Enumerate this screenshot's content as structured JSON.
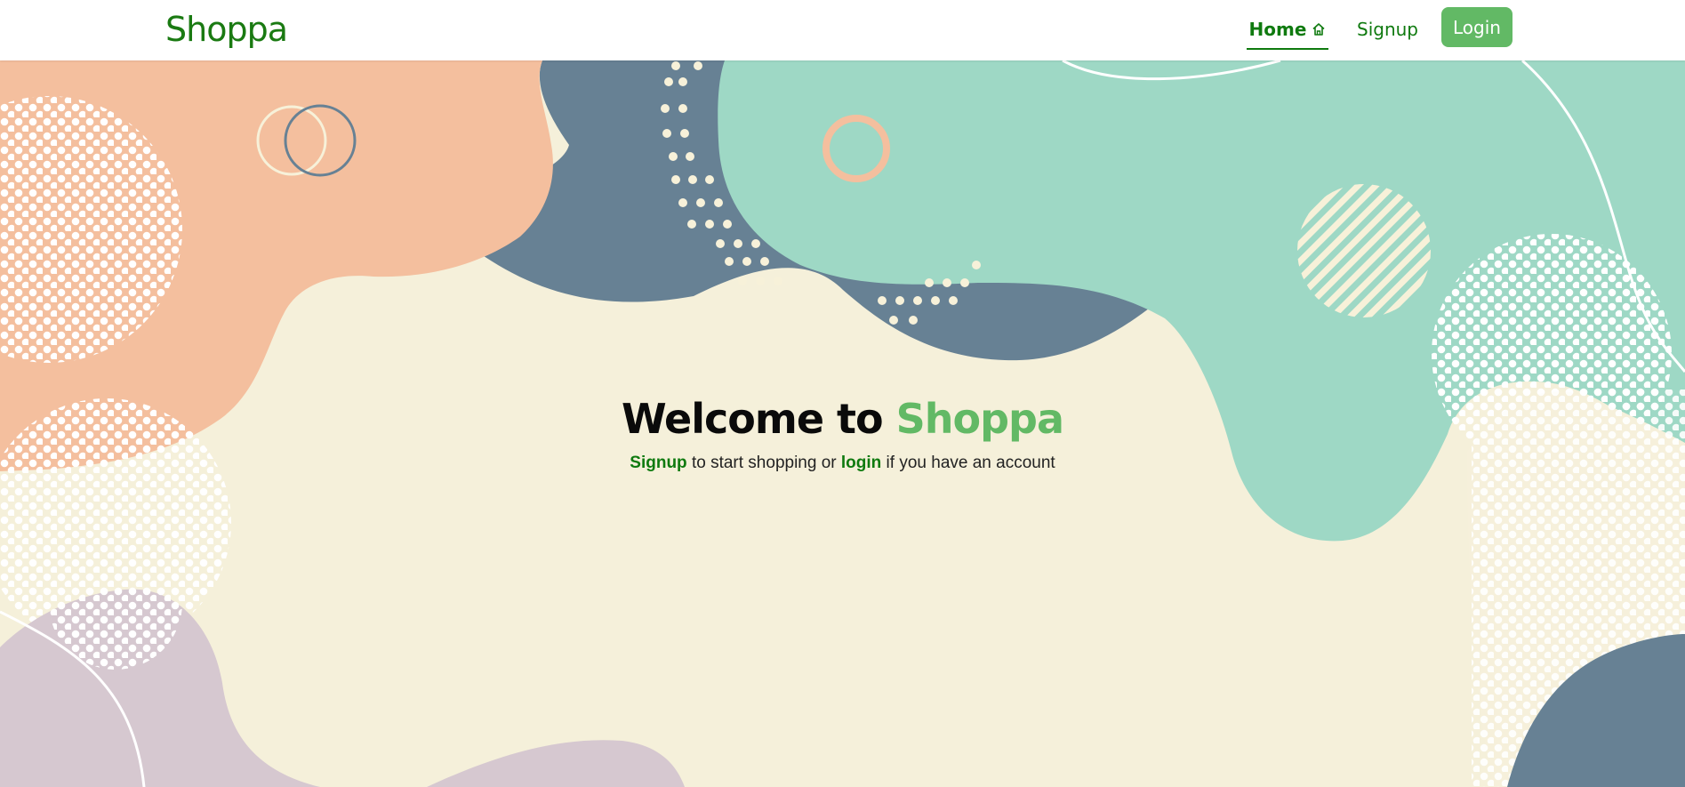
{
  "nav": {
    "brand": "Shoppa",
    "home_label": "Home",
    "signup_label": "Signup",
    "login_label": "Login"
  },
  "hero": {
    "title_prefix": "Welcome to ",
    "title_accent": "Shoppa",
    "subtitle_signup": "Signup",
    "subtitle_mid": " to start shopping or ",
    "subtitle_login": "login",
    "subtitle_end": " if you have an account"
  },
  "colors": {
    "brand_green": "#0f7a0f",
    "accent_green": "#62b965",
    "cream": "#f5f0da",
    "peach": "#f4bf9e",
    "slate": "#678194",
    "mint": "#9ed8c5",
    "lilac": "#d6c8d0"
  },
  "icons": {
    "home": "home-icon"
  }
}
